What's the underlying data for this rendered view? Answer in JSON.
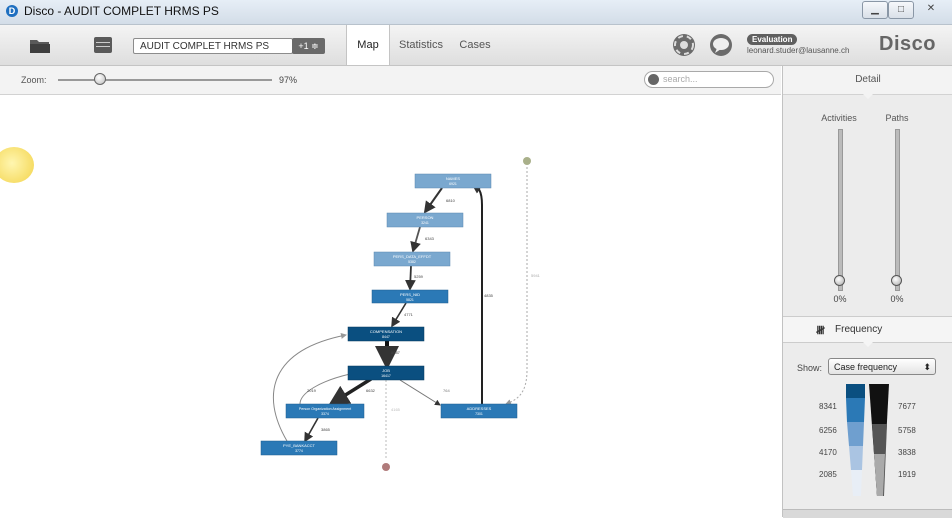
{
  "window": {
    "title": "Disco - AUDIT COMPLET HRMS PS"
  },
  "toolbar": {
    "log_name": "AUDIT COMPLET HRMS PS",
    "log_badge": "+1 ≑",
    "tabs": [
      {
        "label": "Map",
        "active": true
      },
      {
        "label": "Statistics",
        "active": false
      },
      {
        "label": "Cases",
        "active": false
      }
    ],
    "evaluation_label": "Evaluation",
    "user_email": "leonard.studer@lausanne.ch",
    "brand": "Disco"
  },
  "zoom": {
    "label": "Zoom:",
    "value": "97%",
    "level": 0.2
  },
  "search": {
    "placeholder": "search..."
  },
  "sidebar": {
    "header": "Detail",
    "activities_label": "Activities",
    "paths_label": "Paths",
    "activities_value": "0%",
    "paths_value": "0%",
    "frequency_label": "Frequency",
    "frequency_icon": "tally-icon",
    "show_label": "Show:",
    "show_value": "Case frequency",
    "legend_left": [
      "8341",
      "6256",
      "4170",
      "2085"
    ],
    "legend_right": [
      "7677",
      "5758",
      "3838",
      "1919"
    ]
  },
  "colors": {
    "node_dark": "#0a4f80",
    "node_mid": "#2b79b6",
    "node_light": "#7aa8cf",
    "edge": "#444444"
  },
  "map": {
    "nodes": [
      {
        "id": "names",
        "label": "NAMES",
        "count": "6921",
        "shade": "light"
      },
      {
        "id": "person",
        "label": "PERSON",
        "count": "3241",
        "shade": "light"
      },
      {
        "id": "pers_data",
        "label": "PERS_DATA_EFFDT",
        "count": "5382",
        "shade": "light"
      },
      {
        "id": "pers_nid",
        "label": "PERS_NID",
        "count": "5821",
        "shade": "mid"
      },
      {
        "id": "compensation",
        "label": "COMPENSATION",
        "count": "8447",
        "shade": "dark"
      },
      {
        "id": "job",
        "label": "JOB",
        "count": "16417",
        "shade": "dark"
      },
      {
        "id": "poa",
        "label": "Person Organization Assignment",
        "count": "3374",
        "shade": "mid"
      },
      {
        "id": "addresses",
        "label": "ADDRESSES",
        "count": "7301",
        "shade": "mid"
      },
      {
        "id": "pye_bankacct",
        "label": "PYE_BANKACCT",
        "count": "3774",
        "shade": "mid"
      }
    ],
    "edge_labels": [
      {
        "id": "names_person",
        "value": "6810"
      },
      {
        "id": "person_persdata",
        "value": "6343"
      },
      {
        "id": "persdata_persnid",
        "value": "5259"
      },
      {
        "id": "persnid_comp",
        "value": "4771"
      },
      {
        "id": "comp_job",
        "value": "8087"
      },
      {
        "id": "job_poa",
        "value": "6632"
      },
      {
        "id": "job_poa_left",
        "value": "2019"
      },
      {
        "id": "job_addresses",
        "value": "764"
      },
      {
        "id": "poa_pye",
        "value": "3865"
      },
      {
        "id": "addresses_names",
        "value": "4835"
      },
      {
        "id": "start_addresses",
        "value": "5941"
      },
      {
        "id": "job_end",
        "value": "4165"
      }
    ]
  }
}
